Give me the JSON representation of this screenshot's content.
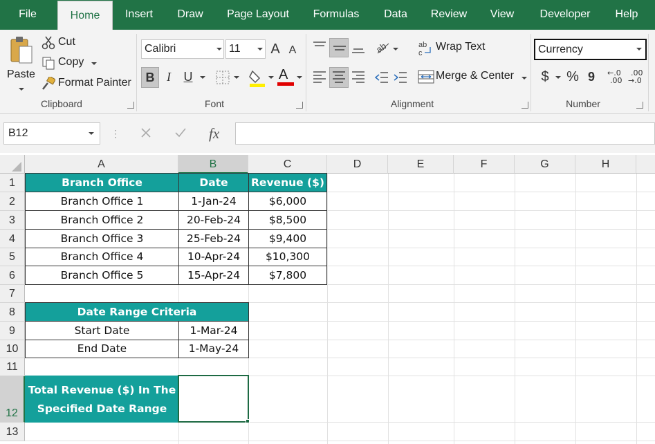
{
  "menu": {
    "items": [
      "File",
      "Home",
      "Insert",
      "Draw",
      "Page Layout",
      "Formulas",
      "Data",
      "Review",
      "View",
      "Developer",
      "Help"
    ],
    "active": "Home"
  },
  "ribbon": {
    "clipboard": {
      "paste_label": "Paste",
      "cut_label": "Cut",
      "copy_label": "Copy",
      "format_painter_label": "Format Painter",
      "group_label": "Clipboard"
    },
    "font": {
      "font_name": "Calibri",
      "font_size": "11",
      "grow_label": "A",
      "shrink_label": "A",
      "bold_label": "B",
      "italic_label": "I",
      "underline_label": "U",
      "font_color_label": "A",
      "group_label": "Font"
    },
    "alignment": {
      "wrap_text_label": "Wrap Text",
      "merge_center_label": "Merge & Center",
      "group_label": "Alignment"
    },
    "number": {
      "format": "Currency",
      "currency_symbol": "$",
      "percent_symbol": "%",
      "comma_symbol": "9",
      "inc_decimal_top": "←.0",
      "inc_decimal_bottom": ".00",
      "dec_decimal_top": ".00",
      "dec_decimal_bottom": "→.0",
      "group_label": "Number"
    }
  },
  "formula_bar": {
    "name_box": "B12",
    "fx_label": "fx",
    "formula": ""
  },
  "sheet": {
    "columns": [
      "A",
      "B",
      "C",
      "D",
      "E",
      "F",
      "G",
      "H"
    ],
    "selected_column": "B",
    "rows": [
      "1",
      "2",
      "3",
      "4",
      "5",
      "6",
      "7",
      "8",
      "9",
      "10",
      "11",
      "12",
      "13"
    ],
    "selected_row": "12",
    "table": {
      "headers": [
        "Branch Office",
        "Date",
        "Revenue ($)"
      ],
      "rows": [
        [
          "Branch Office 1",
          "1-Jan-24",
          "$6,000"
        ],
        [
          "Branch Office 2",
          "20-Feb-24",
          "$8,500"
        ],
        [
          "Branch Office 3",
          "25-Feb-24",
          "$9,400"
        ],
        [
          "Branch Office 4",
          "10-Apr-24",
          "$10,300"
        ],
        [
          "Branch Office 5",
          "15-Apr-24",
          "$7,800"
        ]
      ]
    },
    "criteria": {
      "title": "Date Range Criteria",
      "start_label": "Start Date",
      "start_value": "1-Mar-24",
      "end_label": "End Date",
      "end_value": "1-May-24"
    },
    "result": {
      "label_line1": "Total Revenue ($) In The",
      "label_line2": "Specified Date Range",
      "value": ""
    }
  },
  "colors": {
    "excel_green": "#217346",
    "header_teal": "#14a09b",
    "selection_green": "#1d6a43"
  }
}
